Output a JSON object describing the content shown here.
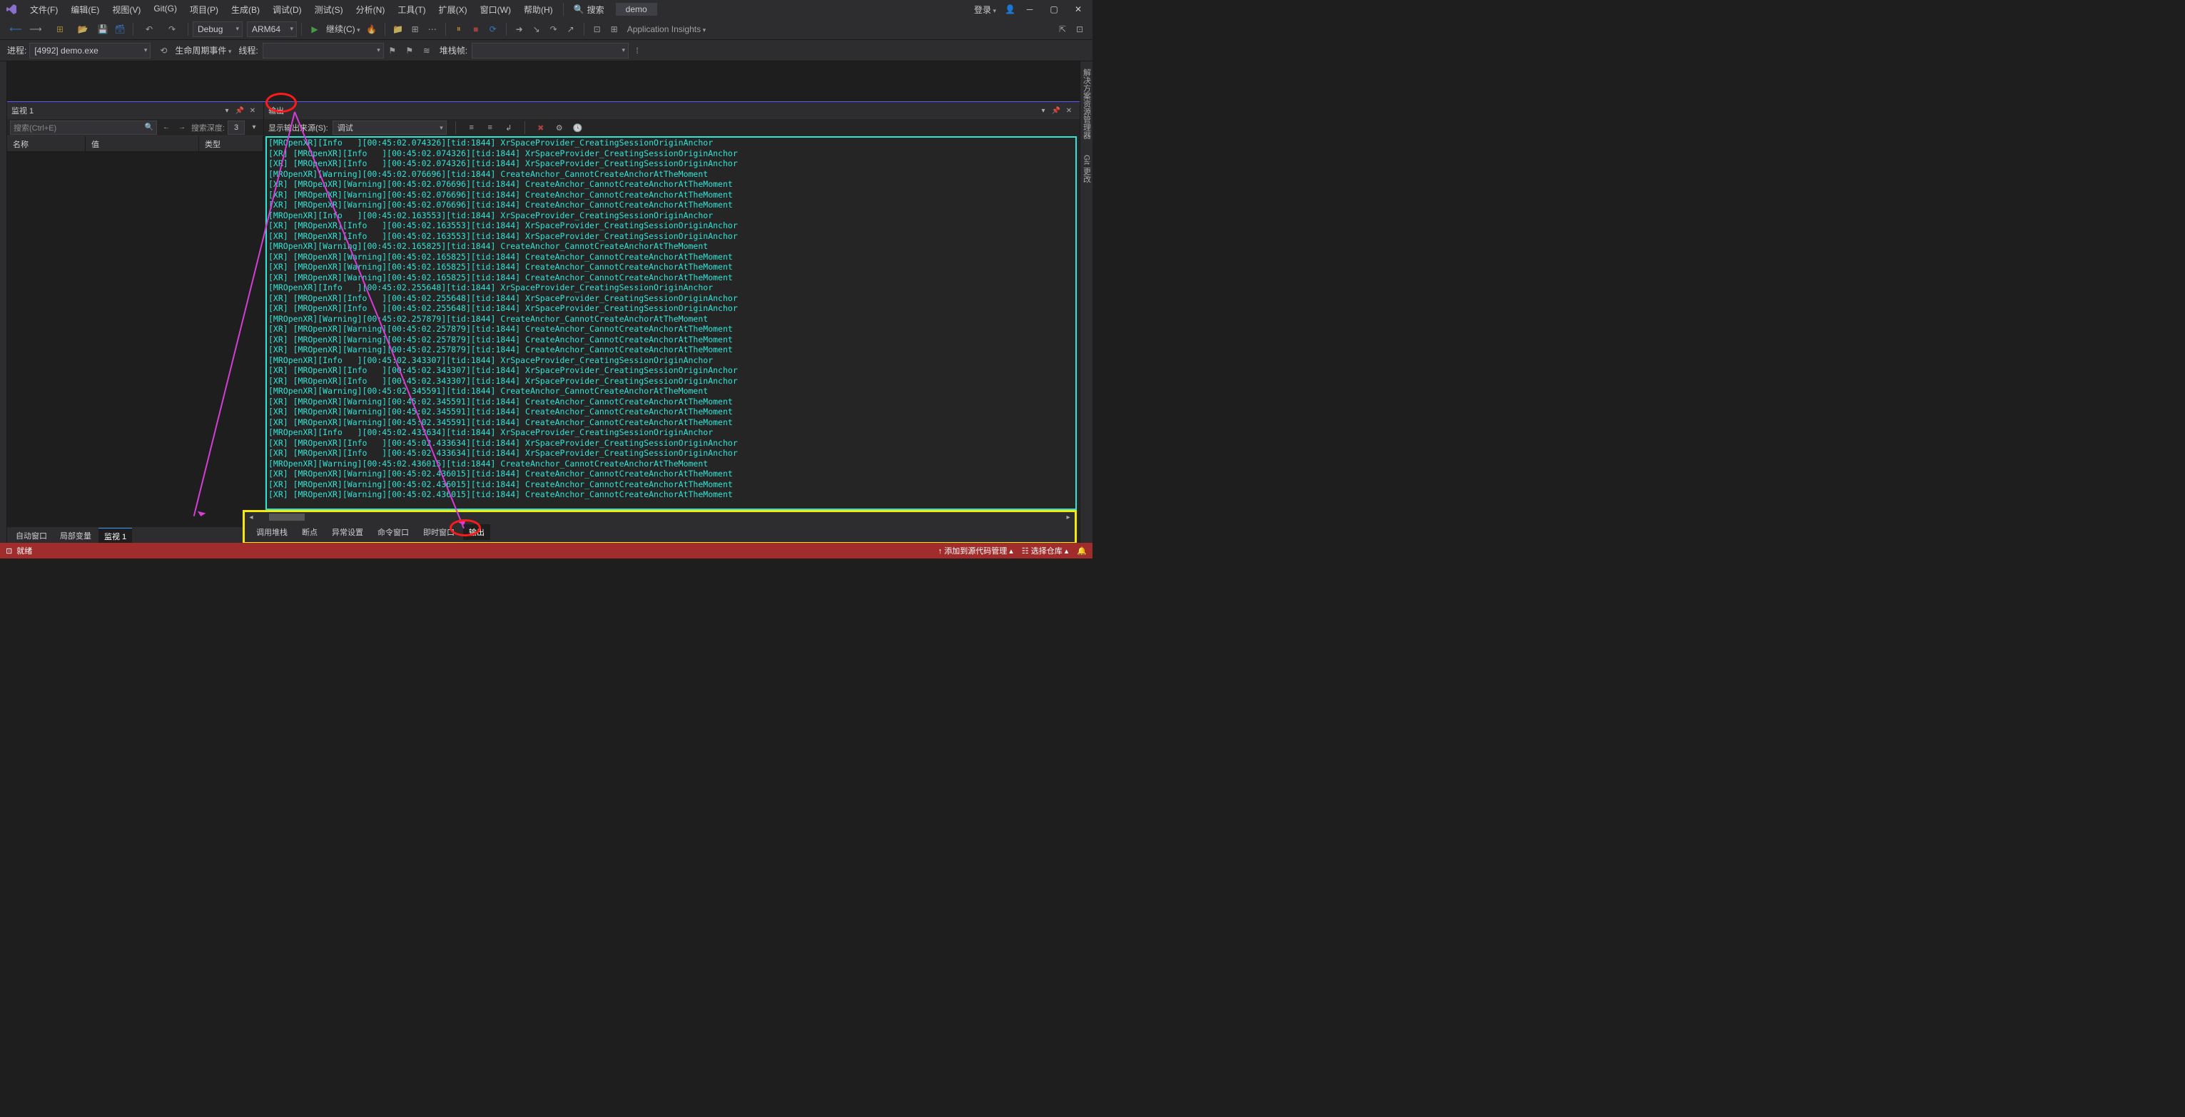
{
  "title_menu": {
    "items": [
      "文件(F)",
      "编辑(E)",
      "视图(V)",
      "Git(G)",
      "项目(P)",
      "生成(B)",
      "调试(D)",
      "测试(S)",
      "分析(N)",
      "工具(T)",
      "扩展(X)",
      "窗口(W)",
      "帮助(H)"
    ],
    "search_label": "搜索",
    "solution": "demo",
    "login": "登录"
  },
  "toolbar1": {
    "config": "Debug",
    "platform": "ARM64",
    "continue": "继续(C)",
    "insights": "Application Insights"
  },
  "toolbar2": {
    "process_label": "进程:",
    "process": "[4992] demo.exe",
    "lifecycle": "生命周期事件",
    "thread_label": "线程:",
    "stack_label": "堆栈帧:"
  },
  "watch": {
    "title": "监视 1",
    "search_placeholder": "搜索(Ctrl+E)",
    "depth_label": "搜索深度:",
    "depth": "3",
    "cols": {
      "name": "名称",
      "value": "值",
      "type": "类型"
    },
    "tabs": [
      "自动窗口",
      "局部变量",
      "监视 1"
    ],
    "active_tab": 2
  },
  "output": {
    "title": "输出",
    "src_label": "显示输出来源(S):",
    "src_value": "调试",
    "tabs": [
      "调用堆栈",
      "断点",
      "异常设置",
      "命令窗口",
      "即时窗口",
      "输出"
    ],
    "active_tab": 5,
    "log_lines": [
      "[MROpenXR][Info   ][00:45:02.074326][tid:1844] XrSpaceProvider_CreatingSessionOriginAnchor",
      "[XR] [MROpenXR][Info   ][00:45:02.074326][tid:1844] XrSpaceProvider_CreatingSessionOriginAnchor",
      "[XR] [MROpenXR][Info   ][00:45:02.074326][tid:1844] XrSpaceProvider_CreatingSessionOriginAnchor",
      "[MROpenXR][Warning][00:45:02.076696][tid:1844] CreateAnchor_CannotCreateAnchorAtTheMoment",
      "[XR] [MROpenXR][Warning][00:45:02.076696][tid:1844] CreateAnchor_CannotCreateAnchorAtTheMoment",
      "[XR] [MROpenXR][Warning][00:45:02.076696][tid:1844] CreateAnchor_CannotCreateAnchorAtTheMoment",
      "[XR] [MROpenXR][Warning][00:45:02.076696][tid:1844] CreateAnchor_CannotCreateAnchorAtTheMoment",
      "[MROpenXR][Info   ][00:45:02.163553][tid:1844] XrSpaceProvider_CreatingSessionOriginAnchor",
      "[XR] [MROpenXR][Info   ][00:45:02.163553][tid:1844] XrSpaceProvider_CreatingSessionOriginAnchor",
      "[XR] [MROpenXR][Info   ][00:45:02.163553][tid:1844] XrSpaceProvider_CreatingSessionOriginAnchor",
      "[MROpenXR][Warning][00:45:02.165825][tid:1844] CreateAnchor_CannotCreateAnchorAtTheMoment",
      "[XR] [MROpenXR][Warning][00:45:02.165825][tid:1844] CreateAnchor_CannotCreateAnchorAtTheMoment",
      "[XR] [MROpenXR][Warning][00:45:02.165825][tid:1844] CreateAnchor_CannotCreateAnchorAtTheMoment",
      "[XR] [MROpenXR][Warning][00:45:02.165825][tid:1844] CreateAnchor_CannotCreateAnchorAtTheMoment",
      "[MROpenXR][Info   ][00:45:02.255648][tid:1844] XrSpaceProvider_CreatingSessionOriginAnchor",
      "[XR] [MROpenXR][Info   ][00:45:02.255648][tid:1844] XrSpaceProvider_CreatingSessionOriginAnchor",
      "[XR] [MROpenXR][Info   ][00:45:02.255648][tid:1844] XrSpaceProvider_CreatingSessionOriginAnchor",
      "[MROpenXR][Warning][00:45:02.257879][tid:1844] CreateAnchor_CannotCreateAnchorAtTheMoment",
      "[XR] [MROpenXR][Warning][00:45:02.257879][tid:1844] CreateAnchor_CannotCreateAnchorAtTheMoment",
      "[XR] [MROpenXR][Warning][00:45:02.257879][tid:1844] CreateAnchor_CannotCreateAnchorAtTheMoment",
      "[XR] [MROpenXR][Warning][00:45:02.257879][tid:1844] CreateAnchor_CannotCreateAnchorAtTheMoment",
      "[MROpenXR][Info   ][00:45:02.343307][tid:1844] XrSpaceProvider_CreatingSessionOriginAnchor",
      "[XR] [MROpenXR][Info   ][00:45:02.343307][tid:1844] XrSpaceProvider_CreatingSessionOriginAnchor",
      "[XR] [MROpenXR][Info   ][00:45:02.343307][tid:1844] XrSpaceProvider_CreatingSessionOriginAnchor",
      "[MROpenXR][Warning][00:45:02.345591][tid:1844] CreateAnchor_CannotCreateAnchorAtTheMoment",
      "[XR] [MROpenXR][Warning][00:45:02.345591][tid:1844] CreateAnchor_CannotCreateAnchorAtTheMoment",
      "[XR] [MROpenXR][Warning][00:45:02.345591][tid:1844] CreateAnchor_CannotCreateAnchorAtTheMoment",
      "[XR] [MROpenXR][Warning][00:45:02.345591][tid:1844] CreateAnchor_CannotCreateAnchorAtTheMoment",
      "[MROpenXR][Info   ][00:45:02.433634][tid:1844] XrSpaceProvider_CreatingSessionOriginAnchor",
      "[XR] [MROpenXR][Info   ][00:45:02.433634][tid:1844] XrSpaceProvider_CreatingSessionOriginAnchor",
      "[XR] [MROpenXR][Info   ][00:45:02.433634][tid:1844] XrSpaceProvider_CreatingSessionOriginAnchor",
      "[MROpenXR][Warning][00:45:02.436015][tid:1844] CreateAnchor_CannotCreateAnchorAtTheMoment",
      "[XR] [MROpenXR][Warning][00:45:02.436015][tid:1844] CreateAnchor_CannotCreateAnchorAtTheMoment",
      "[XR] [MROpenXR][Warning][00:45:02.436015][tid:1844] CreateAnchor_CannotCreateAnchorAtTheMoment",
      "[XR] [MROpenXR][Warning][00:45:02.436015][tid:1844] CreateAnchor_CannotCreateAnchorAtTheMoment"
    ]
  },
  "side_tabs": {
    "sln": "解决方案资源管理器",
    "git": "Git 更改"
  },
  "statusbar": {
    "ready": "就绪",
    "add_src": "添加到源代码管理",
    "repo": "选择仓库"
  }
}
